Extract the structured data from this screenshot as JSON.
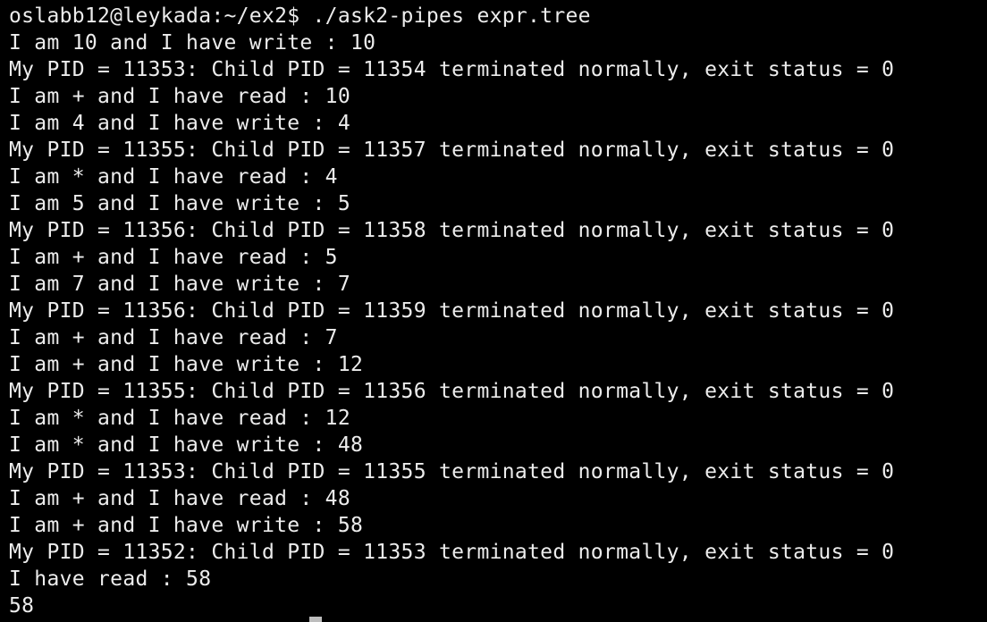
{
  "terminal": {
    "prompt": "oslabb12@leykada:~/ex2$ ./ask2-pipes expr.tree",
    "lines": [
      "I am 10 and I have write : 10",
      "My PID = 11353: Child PID = 11354 terminated normally, exit status = 0",
      "I am + and I have read : 10",
      "I am 4 and I have write : 4",
      "My PID = 11355: Child PID = 11357 terminated normally, exit status = 0",
      "I am * and I have read : 4",
      "I am 5 and I have write : 5",
      "My PID = 11356: Child PID = 11358 terminated normally, exit status = 0",
      "I am + and I have read : 5",
      "I am 7 and I have write : 7",
      "My PID = 11356: Child PID = 11359 terminated normally, exit status = 0",
      "I am + and I have read : 7",
      "I am + and I have write : 12",
      "My PID = 11355: Child PID = 11356 terminated normally, exit status = 0",
      "I am * and I have read : 12",
      "I am * and I have write : 48",
      "My PID = 11353: Child PID = 11355 terminated normally, exit status = 0",
      "I am + and I have read : 48",
      "I am + and I have write : 58",
      "My PID = 11352: Child PID = 11353 terminated normally, exit status = 0",
      "I have read : 58",
      "58"
    ]
  },
  "colors": {
    "background": "#000000",
    "text": "#ececec",
    "cursor": "#bdbdbd"
  }
}
